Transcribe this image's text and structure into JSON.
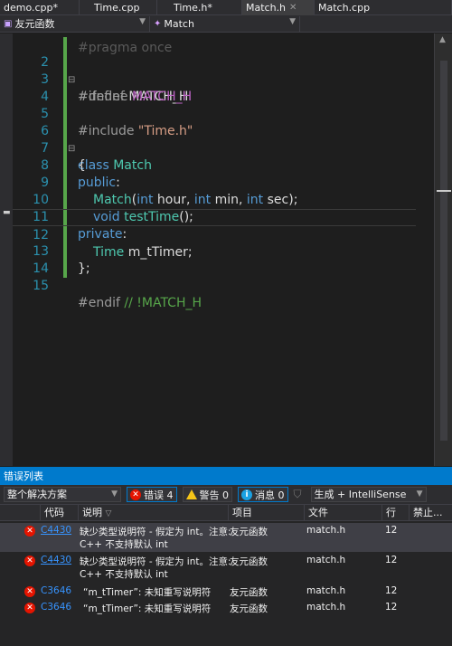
{
  "tabs": [
    {
      "label": "demo.cpp*",
      "closable": false
    },
    {
      "label": "Time.cpp",
      "closable": false
    },
    {
      "label": "Time.h*",
      "closable": false
    },
    {
      "label": "Match.h",
      "closable": true,
      "active": true
    },
    {
      "label": "Match.cpp",
      "closable": false
    }
  ],
  "navbar": {
    "scope": "友元函数",
    "member": "Match"
  },
  "editor": {
    "partial_line": "#pragma once",
    "lines": [
      {
        "num": "2",
        "text": "#ifndef MATCH_H"
      },
      {
        "num": "3",
        "text": "#define MATCH_H"
      },
      {
        "num": "4",
        "text": ""
      },
      {
        "num": "5",
        "text": "#include \"Time.h\""
      },
      {
        "num": "6",
        "text": "class Match"
      },
      {
        "num": "7",
        "text": "{"
      },
      {
        "num": "8",
        "text": "public:"
      },
      {
        "num": "9",
        "text": "Match(int hour, int min, int sec);"
      },
      {
        "num": "10",
        "text": "void testTime();"
      },
      {
        "num": "11",
        "text": "private:"
      },
      {
        "num": "12",
        "text": "Time m_tTimer;"
      },
      {
        "num": "13",
        "text": "};"
      },
      {
        "num": "14",
        "text": ""
      },
      {
        "num": "15",
        "text": "#endif // !MATCH_H"
      }
    ],
    "tokens": {
      "l2_pp": "#ifndef",
      "l2_name": "MATCH_H",
      "l3_pp": "#define",
      "l3_name": "MATCH_H",
      "l5_pp": "#include",
      "l5_str": "\"Time.h\"",
      "l6_kw": "class",
      "l6_name": "Match",
      "l7": "{",
      "l8_kw": "public",
      "l8_colon": ":",
      "l9_fn": "Match",
      "l9_p1": "(",
      "l9_int1": "int",
      "l9_a1": " hour, ",
      "l9_int2": "int",
      "l9_a2": " min, ",
      "l9_int3": "int",
      "l9_a3": " sec);",
      "l10_kw": "void",
      "l10_fn": "testTime",
      "l10_rest": "();",
      "l11_kw": "private",
      "l11_colon": ":",
      "l12_typ": "Time",
      "l12_rest": " m_tTimer;",
      "l13": "};",
      "l15_pp": "#endif",
      "l15_cmt": "// !MATCH_H"
    }
  },
  "errorlist": {
    "title": "错误列表",
    "scope": "整个解决方案",
    "errors_label": "错误 4",
    "warnings_label": "警告 0",
    "messages_label": "消息 0",
    "build_source": "生成 + IntelliSense",
    "columns": [
      "代码",
      "说明",
      "项目",
      "文件",
      "行",
      "禁止..."
    ],
    "rows": [
      {
        "code": "C4430",
        "desc1": "缺少类型说明符 - 假定为 int。注意:",
        "desc2": "C++ 不支持默认 int",
        "project": "友元函数",
        "file": "match.h",
        "line": "12"
      },
      {
        "code": "C4430",
        "desc1": "缺少类型说明符 - 假定为 int。注意:",
        "desc2": "C++ 不支持默认 int",
        "project": "友元函数",
        "file": "match.h",
        "line": "12"
      },
      {
        "code": "C3646",
        "desc1": "“m_tTimer”: 未知重写说明符",
        "desc2": "",
        "project": "友元函数",
        "file": "match.h",
        "line": "12"
      },
      {
        "code": "C3646",
        "desc1": "“m_tTimer”: 未知重写说明符",
        "desc2": "",
        "project": "友元函数",
        "file": "match.h",
        "line": "12"
      }
    ]
  }
}
